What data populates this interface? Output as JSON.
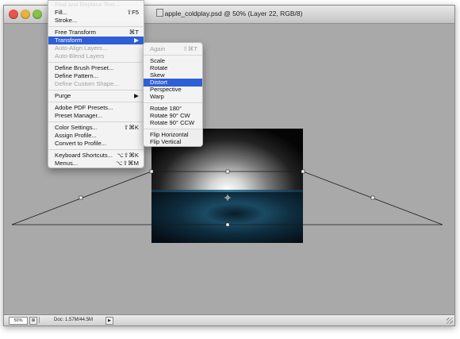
{
  "window": {
    "title": "apple_coldplay.psd @ 50% (Layer 22, RGB/8)"
  },
  "colors": {
    "canvas": "#a9a9a9",
    "highlight": "#2f5fd6",
    "close": "#e8574c",
    "minimize": "#e7b43c",
    "zoom": "#86c24d"
  },
  "edit_menu": {
    "items": [
      {
        "label": "Find and Replace Text...",
        "shortcut": "",
        "disabled": true
      },
      {
        "label": "Fill...",
        "shortcut": "⇧F5",
        "disabled": false
      },
      {
        "label": "Stroke...",
        "shortcut": "",
        "disabled": false
      },
      {
        "label": "Free Transform",
        "shortcut": "⌘T",
        "disabled": false
      },
      {
        "label": "Transform",
        "shortcut": "▶",
        "disabled": false,
        "highlighted": true
      },
      {
        "label": "Auto-Align Layers...",
        "shortcut": "",
        "disabled": true
      },
      {
        "label": "Auto-Blend Layers",
        "shortcut": "",
        "disabled": true
      },
      {
        "label": "Define Brush Preset...",
        "shortcut": "",
        "disabled": false
      },
      {
        "label": "Define Pattern...",
        "shortcut": "",
        "disabled": false
      },
      {
        "label": "Define Custom Shape...",
        "shortcut": "",
        "disabled": true
      },
      {
        "label": "Purge",
        "shortcut": "▶",
        "disabled": false
      },
      {
        "label": "Adobe PDF Presets...",
        "shortcut": "",
        "disabled": false
      },
      {
        "label": "Preset Manager...",
        "shortcut": "",
        "disabled": false
      },
      {
        "label": "Color Settings...",
        "shortcut": "⇧⌘K",
        "disabled": false
      },
      {
        "label": "Assign Profile...",
        "shortcut": "",
        "disabled": false
      },
      {
        "label": "Convert to Profile...",
        "shortcut": "",
        "disabled": false
      },
      {
        "label": "Keyboard Shortcuts...",
        "shortcut": "⌥⇧⌘K",
        "disabled": false
      },
      {
        "label": "Menus...",
        "shortcut": "⌥⇧⌘M",
        "disabled": false
      }
    ]
  },
  "transform_submenu": {
    "items": [
      {
        "label": "Again",
        "shortcut": "⇧⌘T",
        "disabled": true
      },
      {
        "label": "Scale",
        "shortcut": "",
        "disabled": false
      },
      {
        "label": "Rotate",
        "shortcut": "",
        "disabled": false
      },
      {
        "label": "Skew",
        "shortcut": "",
        "disabled": false
      },
      {
        "label": "Distort",
        "shortcut": "",
        "disabled": false,
        "highlighted": true
      },
      {
        "label": "Perspective",
        "shortcut": "",
        "disabled": false
      },
      {
        "label": "Warp",
        "shortcut": "",
        "disabled": false
      },
      {
        "label": "Rotate 180°",
        "shortcut": "",
        "disabled": false
      },
      {
        "label": "Rotate 90° CW",
        "shortcut": "",
        "disabled": false
      },
      {
        "label": "Rotate 90° CCW",
        "shortcut": "",
        "disabled": false
      },
      {
        "label": "Flip Horizontal",
        "shortcut": "",
        "disabled": false
      },
      {
        "label": "Flip Vertical",
        "shortcut": "",
        "disabled": false
      }
    ]
  },
  "statusbar": {
    "zoom": "50%",
    "doc_size": "Doc: 1.57M/44.5M",
    "arrow": "▶"
  }
}
